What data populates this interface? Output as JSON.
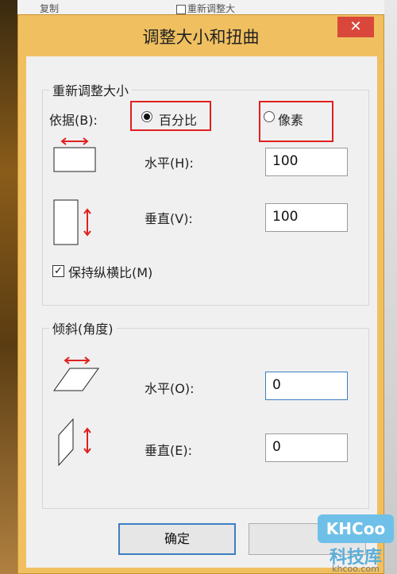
{
  "background": {
    "left_text": "复制",
    "right_text": "重新调整大"
  },
  "dialog": {
    "title": "调整大小和扭曲",
    "close_label": "✕"
  },
  "resize": {
    "group_label": "重新调整大小",
    "basis_label": "依据(B):",
    "options": [
      {
        "label": "百分比",
        "selected": true
      },
      {
        "label": "像素",
        "selected": false
      }
    ],
    "horizontal_label": "水平(H):",
    "horizontal_value": "100",
    "vertical_label": "垂直(V):",
    "vertical_value": "100",
    "keep_ratio_label": "保持纵横比(M)",
    "keep_ratio_checked": true
  },
  "skew": {
    "group_label": "倾斜(角度)",
    "horizontal_label": "水平(O):",
    "horizontal_value": "0",
    "vertical_label": "垂直(E):",
    "vertical_value": "0"
  },
  "buttons": {
    "ok": "确定",
    "cancel": ""
  },
  "watermark": {
    "badge": "KHCoo",
    "name": "科技库",
    "url": "khcoo.com"
  },
  "colors": {
    "accent_red": "#e0201e",
    "focus_blue": "#3c7fc4",
    "title_bar": "#f0c060"
  }
}
